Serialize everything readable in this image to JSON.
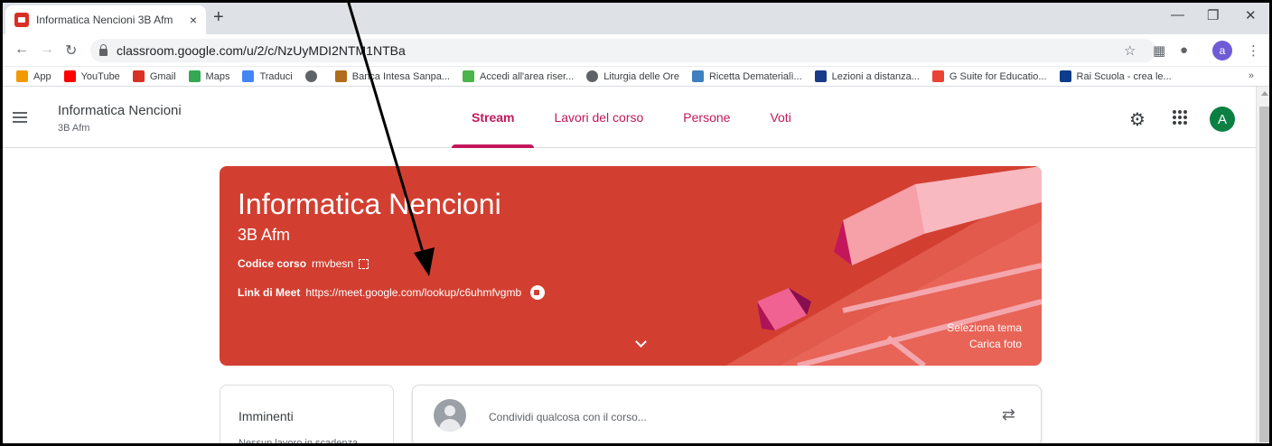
{
  "browser": {
    "tab_title": "Informatica Nencioni 3B Afm",
    "tab_close": "×",
    "new_tab": "+",
    "url": "classroom.google.com/u/2/c/NzUyMDI2NTM1NTBa",
    "profile_initial": "a",
    "bookmarks": [
      {
        "label": "App",
        "icon": "apps-grid-icon",
        "color": "#f29900"
      },
      {
        "label": "YouTube",
        "icon": "youtube-icon",
        "color": "#ff0000"
      },
      {
        "label": "Gmail",
        "icon": "gmail-icon",
        "color": "#d93025"
      },
      {
        "label": "Maps",
        "icon": "maps-pin-icon",
        "color": "#34a853"
      },
      {
        "label": "Traduci",
        "icon": "translate-icon",
        "color": "#4285f4"
      },
      {
        "label": "",
        "icon": "globe-icon",
        "color": "#5f6368"
      },
      {
        "label": "Banca Intesa Sanpa...",
        "icon": "bank-icon",
        "color": "#b06d1e"
      },
      {
        "label": "Accedi all'area riser...",
        "icon": "sparkle-icon",
        "color": "#4ab54a"
      },
      {
        "label": "Liturgia delle Ore",
        "icon": "globe-icon",
        "color": "#5f6368"
      },
      {
        "label": "Ricetta Dematerialì...",
        "icon": "doc-icon",
        "color": "#3f7fbf"
      },
      {
        "label": "Lezioni a distanza...",
        "icon": "c2-icon",
        "color": "#1a3a8a"
      },
      {
        "label": "G Suite for Educatio...",
        "icon": "dots-icon",
        "color": "#ea4335"
      },
      {
        "label": "Rai Scuola - crea le...",
        "icon": "rai-icon",
        "color": "#0d3c8a"
      }
    ],
    "bookmarks_more": "»"
  },
  "classroom": {
    "class_name": "Informatica Nencioni",
    "section": "3B Afm",
    "tabs": [
      "Stream",
      "Lavori del corso",
      "Persone",
      "Voti"
    ],
    "avatar_initial": "A"
  },
  "banner": {
    "title": "Informatica Nencioni",
    "subtitle": "3B Afm",
    "code_label": "Codice corso",
    "code_value": "rmvbesn",
    "meet_label": "Link di Meet",
    "meet_url": "https://meet.google.com/lookup/c6uhmfvgmb",
    "select_theme": "Seleziona tema",
    "upload_photo": "Carica foto",
    "color": "#d23f31"
  },
  "upcoming": {
    "title": "Imminenti",
    "empty_text": "Nessun lavoro in scadenza"
  },
  "share": {
    "placeholder": "Condividi qualcosa con il corso..."
  }
}
